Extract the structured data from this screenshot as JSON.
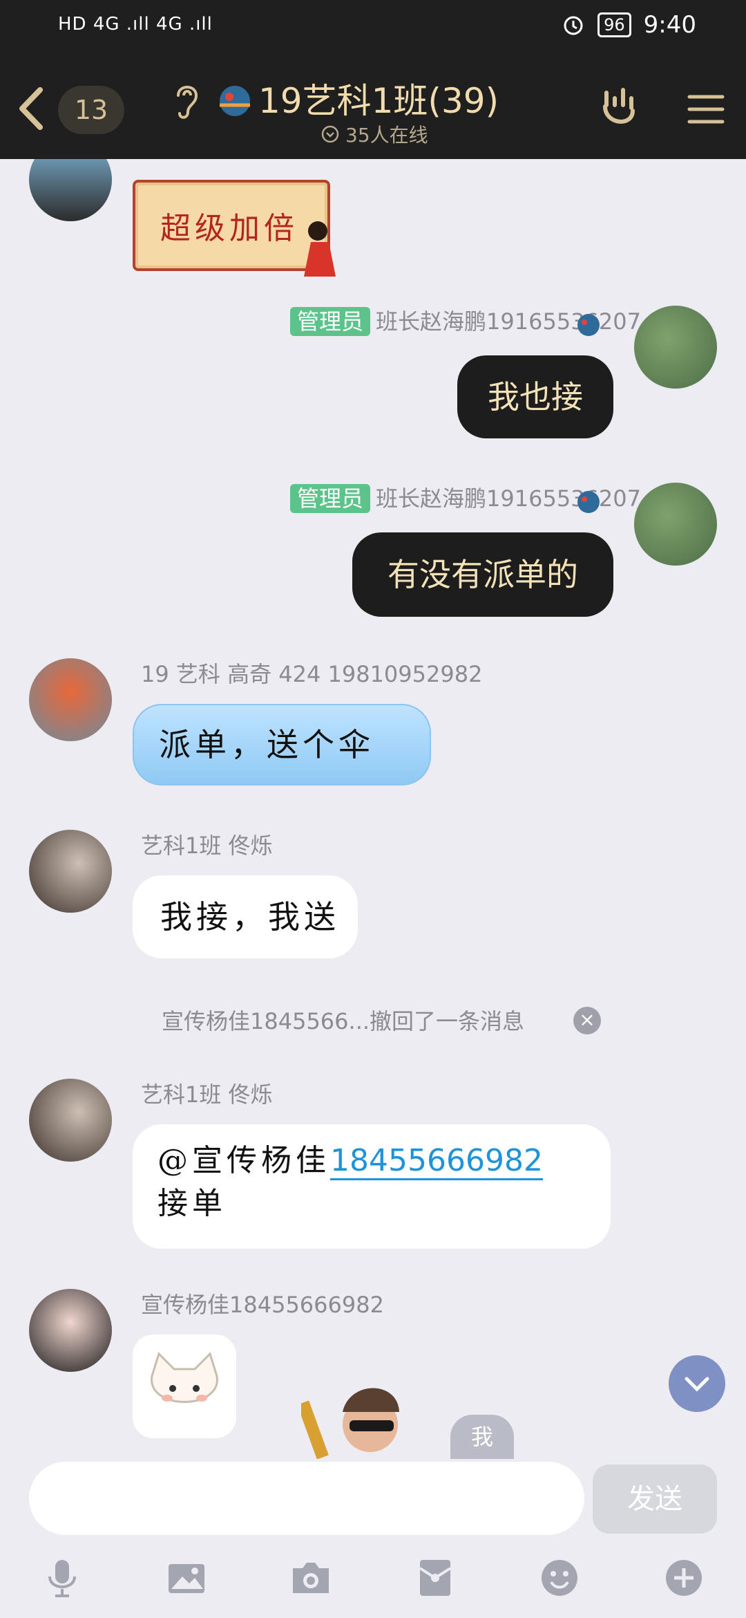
{
  "status_bar": {
    "left_text": "HD 4G .ıll 4G .ıll",
    "battery": "96",
    "time": "9:40"
  },
  "header": {
    "unread_count": "13",
    "title": "19艺科1班(39)",
    "online": "35人在线"
  },
  "messages": {
    "m1": {
      "sticker_text": "超级加倍"
    },
    "m2": {
      "admin_tag": "管理员",
      "sender": "班长赵海鹏19165536207",
      "text": "我也接"
    },
    "m3": {
      "admin_tag": "管理员",
      "sender": "班长赵海鹏19165536207",
      "text": "有没有派单的"
    },
    "m4": {
      "sender": "19 艺科 高奇 424 19810952982",
      "text": "派单，送个伞"
    },
    "m5": {
      "sender": "艺科1班 佟烁",
      "text": "我接，我送"
    },
    "recall": "宣传杨佳1845566...撤回了一条消息",
    "m6": {
      "sender": "艺科1班 佟烁",
      "prefix": "@宣传杨佳",
      "link": "18455666982",
      "suffix": " 接单"
    },
    "m7": {
      "sender": "宣传杨佳18455666982"
    }
  },
  "me_chip": "我",
  "input": {
    "placeholder": ""
  },
  "send_label": "发送",
  "colors": {
    "header_bg": "#1f1f1f",
    "title": "#f2dcae",
    "admin": "#5cc38a",
    "link": "#1f93d8",
    "dark_bubble": "#1d1d1d"
  },
  "toolbar_icons": [
    "mic-icon",
    "image-icon",
    "camera-icon",
    "red-packet-icon",
    "emoji-icon",
    "plus-icon"
  ]
}
